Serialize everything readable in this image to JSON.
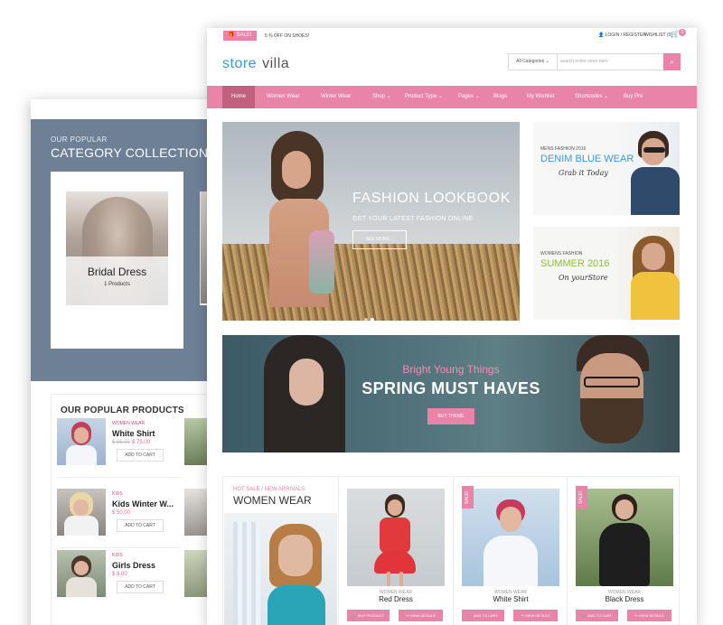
{
  "back": {
    "category": {
      "kicker": "OUR POPULAR",
      "title": "CATEGORY COLLECTION",
      "card_name": "Bridal Dress",
      "card_count": "1 Products"
    },
    "products": {
      "title": "OUR POPULAR PRODUCTS",
      "items": [
        {
          "category": "WOMEN WEAR",
          "name": "White Shirt",
          "old_price": "$ 85.00",
          "price": "$ 75.00",
          "button": "ADD TO CART"
        },
        {
          "category": "KIDS",
          "name": "Kids Winter W...",
          "old_price": "",
          "price": "$ 50.00",
          "button": "ADD TO CART"
        },
        {
          "category": "KIDS",
          "name": "Girls Dress",
          "old_price": "",
          "price": "$ 8.00",
          "button": "ADD TO CART"
        }
      ]
    }
  },
  "front": {
    "topbar": {
      "sale": "SALE!",
      "promo": "5 % OFF ON SHOES!",
      "login": "LOGIN / REGISTER",
      "wishlist": "WISHLIST (0)",
      "cart_count": "0"
    },
    "logo": {
      "part1": "store",
      "part2": "villa"
    },
    "search": {
      "category": "All Categories",
      "placeholder": "search entire store here"
    },
    "nav": [
      {
        "label": "Home"
      },
      {
        "label": "Women Wear"
      },
      {
        "label": "Winter Wear"
      },
      {
        "label": "Shop ⌄"
      },
      {
        "label": "Product Type ⌄"
      },
      {
        "label": "Pages ⌄"
      },
      {
        "label": "Blogs"
      },
      {
        "label": "My Wishlist"
      },
      {
        "label": "Shortcodes ⌄"
      },
      {
        "label": "Buy Pro"
      }
    ],
    "hero": {
      "title": "FASHION LOOKBOOK",
      "subtitle": "GET YOUR LATEST FASHION ONLINE",
      "button": "SEE MORE..."
    },
    "side1": {
      "kicker": "MENS FASHION 2016",
      "title": "DENIM BLUE WEAR",
      "script": "Grab it Today"
    },
    "side2": {
      "kicker": "WOMENS FASHION",
      "title": "SUMMER 2016",
      "script": "On yourStore"
    },
    "spring": {
      "subtitle": "Bright Young Things",
      "title": "SPRING MUST HAVES",
      "button": "BUY THEME"
    },
    "women": {
      "kicker": "HOT SALE / NEW ARRIVALS",
      "title": "WOMEN WEAR",
      "products": [
        {
          "category": "WOMEN WEAR",
          "name": "Red Dress",
          "sale": "",
          "btn1": "BUY PRODUCT",
          "btn2": "VIEW DETAILS"
        },
        {
          "category": "WOMEN WEAR",
          "name": "White Shirt",
          "sale": "SALE!",
          "btn1": "ADD TO CART",
          "btn2": "VIEW DETAILS"
        },
        {
          "category": "WOMEN WEAR",
          "name": "Black Dress",
          "sale": "SALE!",
          "btn1": "ADD TO CART",
          "btn2": "VIEW DETAILS"
        }
      ]
    }
  },
  "colors": {
    "accent": "#e983a8",
    "nav_active": "#c2617f",
    "logo_blue": "#3a98d8",
    "category_band": "#6e8096"
  }
}
